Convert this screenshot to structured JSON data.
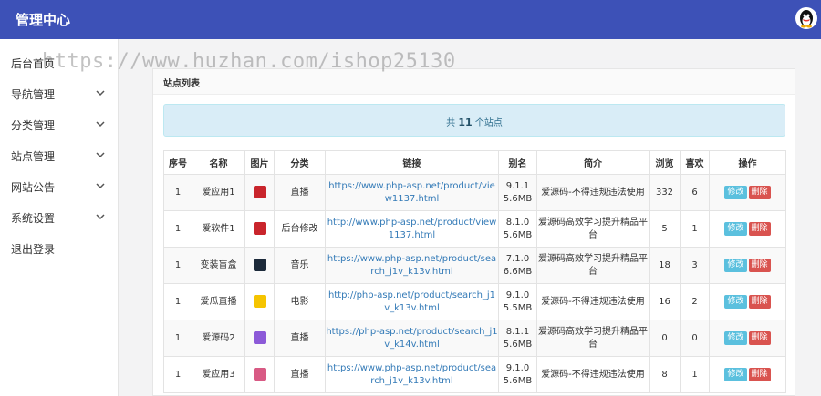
{
  "header": {
    "title": "管理中心"
  },
  "sidebar": {
    "items": [
      {
        "label": "后台首页",
        "has_chevron": false
      },
      {
        "label": "导航管理",
        "has_chevron": true
      },
      {
        "label": "分类管理",
        "has_chevron": true
      },
      {
        "label": "站点管理",
        "has_chevron": true
      },
      {
        "label": "网站公告",
        "has_chevron": true
      },
      {
        "label": "系统设置",
        "has_chevron": true
      },
      {
        "label": "退出登录",
        "has_chevron": false
      }
    ]
  },
  "watermark": "https://www.huzhan.com/ishop25130",
  "panel": {
    "title": "站点列表",
    "summary": {
      "prefix": "共",
      "count": "11",
      "suffix": "个站点"
    }
  },
  "table": {
    "headers": [
      "序号",
      "名称",
      "图片",
      "分类",
      "链接",
      "别名",
      "简介",
      "浏览",
      "喜欢",
      "操作"
    ],
    "rows": [
      {
        "no": "1",
        "name": "爱应用1",
        "icon_color": "#c9252c",
        "category": "直播",
        "link": "https://www.php-asp.net/product/view1137.html",
        "alias": "9.1.1 5.6MB",
        "desc": "爱源码-不得违规违法使用",
        "views": "332",
        "likes": "6"
      },
      {
        "no": "1",
        "name": "爱软件1",
        "icon_color": "#c9252c",
        "category": "后台修改",
        "link": "http://www.php-asp.net/product/view1137.html",
        "alias": "8.1.0 5.6MB",
        "desc": "爱源码高效学习提升精品平台",
        "views": "5",
        "likes": "1"
      },
      {
        "no": "1",
        "name": "变装盲盒",
        "icon_color": "#1c2a3a",
        "category": "音乐",
        "link": "https://www.php-asp.net/product/search_j1v_k13v.html",
        "alias": "7.1.0 6.6MB",
        "desc": "爱源码高效学习提升精品平台",
        "views": "18",
        "likes": "3"
      },
      {
        "no": "1",
        "name": "爱瓜直播",
        "icon_color": "#f5c400",
        "category": "电影",
        "link": "http://php-asp.net/product/search_j1v_k13v.html",
        "alias": "9.1.0 5.5MB",
        "desc": "爱源码-不得违规违法使用",
        "views": "16",
        "likes": "2"
      },
      {
        "no": "1",
        "name": "爱源码2",
        "icon_color": "#8c5ad8",
        "category": "直播",
        "link": "https://php-asp.net/product/search_j1v_k14v.html",
        "alias": "8.1.1 5.6MB",
        "desc": "爱源码高效学习提升精品平台",
        "views": "0",
        "likes": "0"
      },
      {
        "no": "1",
        "name": "爱应用3",
        "icon_color": "#d85a84",
        "category": "直播",
        "link": "https://www.php-asp.net/product/search_j1v_k13v.html",
        "alias": "9.1.0 5.6MB",
        "desc": "爱源码-不得违规违法使用",
        "views": "8",
        "likes": "1"
      }
    ],
    "actions": {
      "edit": "修改",
      "delete": "删除"
    }
  },
  "colors": {
    "topbar": "#3d51b7",
    "edit_button": "#5bc0de",
    "delete_button": "#d9534f",
    "alert_bg": "#d9edf7"
  }
}
